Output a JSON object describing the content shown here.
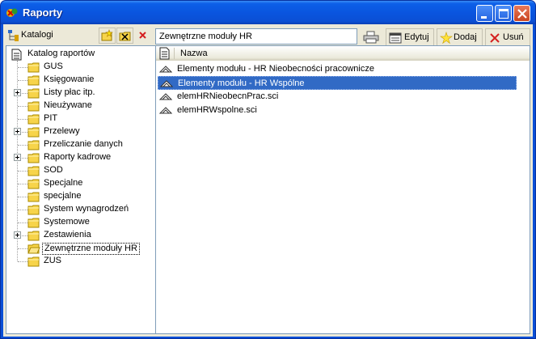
{
  "window": {
    "title": "Raporty",
    "controls": [
      "minimize",
      "maximize",
      "close"
    ]
  },
  "left_panel": {
    "title": "Katalogi",
    "toolbar_icons": [
      "new-folder-icon",
      "delete-folder-icon",
      "close-icon"
    ],
    "tree": {
      "root": "Katalog raportów",
      "items": [
        {
          "label": "GUS",
          "expandable": false
        },
        {
          "label": "Księgowanie",
          "expandable": false
        },
        {
          "label": "Listy płac itp.",
          "expandable": true
        },
        {
          "label": "Nieużywane",
          "expandable": false
        },
        {
          "label": "PIT",
          "expandable": false
        },
        {
          "label": "Przelewy",
          "expandable": true
        },
        {
          "label": "Przeliczanie danych",
          "expandable": false
        },
        {
          "label": "Raporty kadrowe",
          "expandable": true
        },
        {
          "label": "SOD",
          "expandable": false
        },
        {
          "label": "Specjalne",
          "expandable": false
        },
        {
          "label": "specjalne",
          "expandable": false
        },
        {
          "label": "System wynagrodzeń",
          "expandable": false
        },
        {
          "label": "Systemowe",
          "expandable": false
        },
        {
          "label": "Zestawienia",
          "expandable": true
        },
        {
          "label": "Zewnętrzne moduły HR",
          "expandable": false,
          "selected": true
        },
        {
          "label": "ZUS",
          "expandable": false
        }
      ]
    }
  },
  "right_panel": {
    "path_value": "Zewnętrzne moduły HR",
    "buttons": {
      "edit": "Edytuj",
      "add": "Dodaj",
      "remove": "Usuń"
    },
    "list": {
      "column_header": "Nazwa",
      "rows": [
        {
          "label": "Elementy modułu - HR Nieobecności pracownicze",
          "selected": false
        },
        {
          "label": "Elementy modułu - HR Wspólne",
          "selected": true
        },
        {
          "label": "elemHRNieobecnPrac.sci",
          "selected": false
        },
        {
          "label": "elemHRWspolne.sci",
          "selected": false
        }
      ]
    }
  },
  "colors": {
    "titlebar": "#0a55df",
    "selection": "#316ac5",
    "face": "#ece9d8"
  }
}
